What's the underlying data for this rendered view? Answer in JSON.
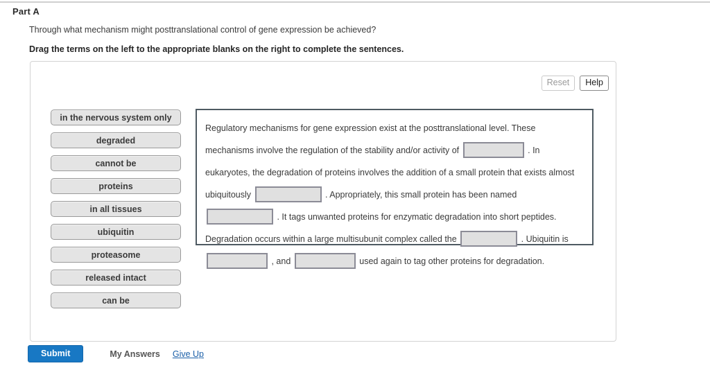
{
  "page": {
    "part_label": "Part A",
    "question": "Through what mechanism might posttranslational control of gene expression be achieved?",
    "instruction": "Drag the terms on the left to the appropriate blanks on the right to complete the sentences."
  },
  "toolbar": {
    "reset_label": "Reset",
    "help_label": "Help"
  },
  "term_bank": {
    "terms": [
      {
        "label": "in the nervous system only"
      },
      {
        "label": "degraded"
      },
      {
        "label": "cannot be"
      },
      {
        "label": "proteins"
      },
      {
        "label": "in all tissues"
      },
      {
        "label": "ubiquitin"
      },
      {
        "label": "proteasome"
      },
      {
        "label": "released intact"
      },
      {
        "label": "can be"
      }
    ]
  },
  "sentence": {
    "segments": [
      {
        "type": "text",
        "value": "Regulatory mechanisms for gene expression exist at the posttranslational level. These mechanisms involve the regulation of the stability and/or activity of"
      },
      {
        "type": "blank",
        "value": "",
        "size": "med"
      },
      {
        "type": "text",
        "value": ". In eukaryotes, the degradation of proteins involves the addition of a small protein that exists almost ubiquitously"
      },
      {
        "type": "blank",
        "value": "",
        "size": "long"
      },
      {
        "type": "text",
        "value": ". Appropriately, this small protein has been named"
      },
      {
        "type": "blank",
        "value": "",
        "size": "long"
      },
      {
        "type": "text",
        "value": ". It tags unwanted proteins for enzymatic degradation into short peptides. Degradation occurs within a large multisubunit complex called the"
      },
      {
        "type": "blank",
        "value": "",
        "size": "short"
      },
      {
        "type": "text",
        "value": ". Ubiquitin is"
      },
      {
        "type": "blank",
        "value": "",
        "size": "med"
      },
      {
        "type": "text",
        "value": ", and"
      },
      {
        "type": "blank",
        "value": "",
        "size": "med"
      },
      {
        "type": "text",
        "value": "used again to tag other proteins for degradation."
      }
    ]
  },
  "footer": {
    "submit_label": "Submit",
    "my_answers_label": "My Answers",
    "give_up_label": "Give Up"
  },
  "colors": {
    "submit_blue": "#1878c4",
    "link_blue": "#1a5fa8",
    "term_fill": "#e4e4e4",
    "blank_fill": "#e0e0e0",
    "sentence_border": "#4e5a62"
  }
}
